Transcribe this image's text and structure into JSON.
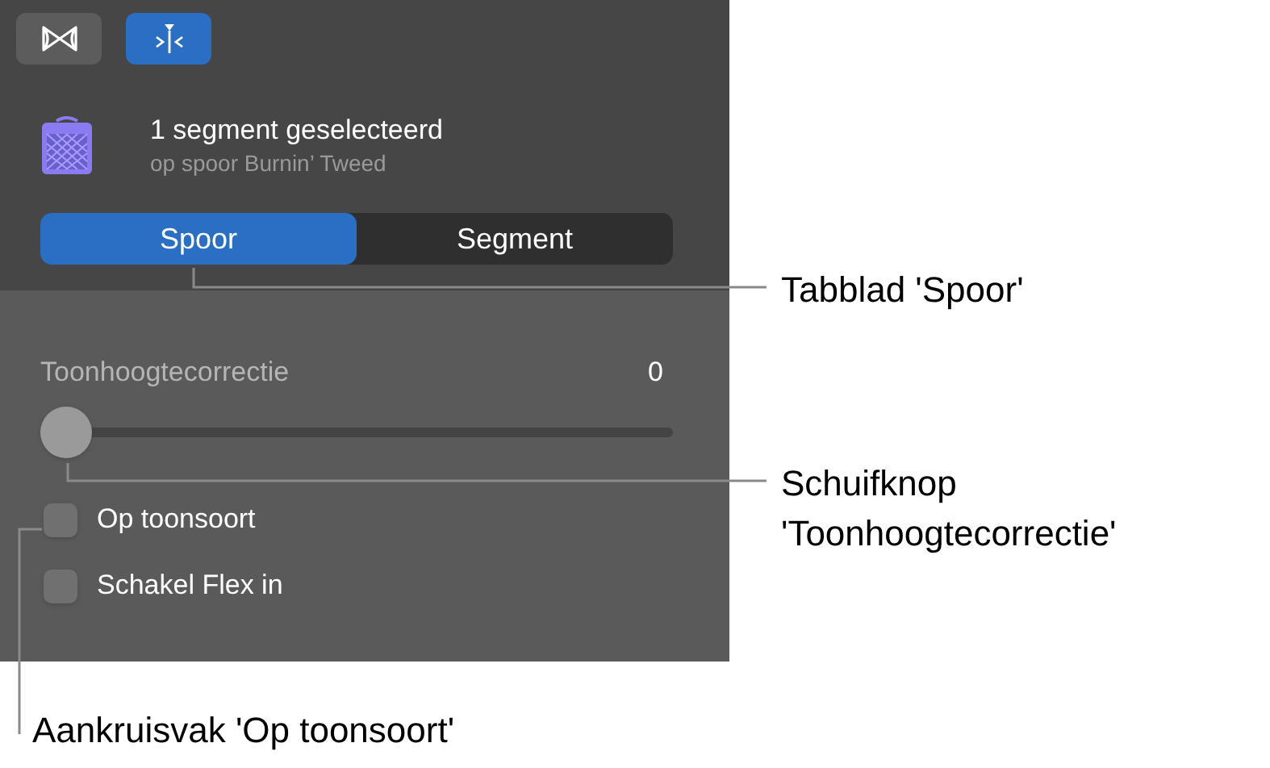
{
  "toolbar": [
    {
      "selected": false
    },
    {
      "selected": true
    }
  ],
  "header": {
    "title": "1 segment geselecteerd",
    "subtitle": "op spoor Burnin’ Tweed"
  },
  "tabs": [
    {
      "label": "Spoor",
      "selected": true
    },
    {
      "label": "Segment",
      "selected": false
    }
  ],
  "slider": {
    "label": "Toonhoogtecorrectie",
    "reading": "0",
    "level": 0
  },
  "checkboxes": [
    {
      "label": "Op toonsoort",
      "checked": false
    },
    {
      "label": "Schakel Flex in",
      "checked": false
    }
  ],
  "callouts": [
    {
      "lines": [
        "Tabblad 'Spoor'"
      ]
    },
    {
      "lines": [
        "Schuifknop",
        "'Toonhoogtecorrectie'"
      ]
    },
    {
      "lines": [
        "Aankruisvak 'Op toonsoort'"
      ]
    }
  ]
}
